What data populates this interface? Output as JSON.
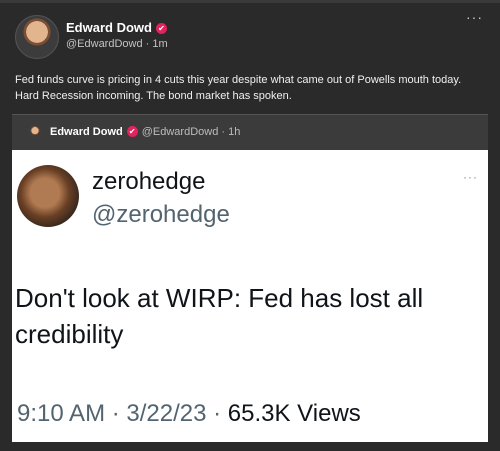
{
  "post": {
    "author": "Edward Dowd",
    "verified_mark": "✔",
    "handle": "@EdwardDowd",
    "time": "· 1m",
    "text": "Fed funds curve is pricing in 4 cuts this year despite what came out of Powells mouth today. Hard Recession incoming. The bond market has spoken.",
    "more_icon": "···"
  },
  "quote": {
    "author": "Edward Dowd",
    "verified_mark": "✔",
    "meta": "@EdwardDowd · 1h"
  },
  "tweet": {
    "name": "zerohedge",
    "handle": "@zerohedge",
    "more_icon": "···",
    "text": "Don't look at WIRP: Fed has lost all credibility",
    "time": "9:10 AM · 3/22/23 · ",
    "views": "65.3K Views"
  }
}
